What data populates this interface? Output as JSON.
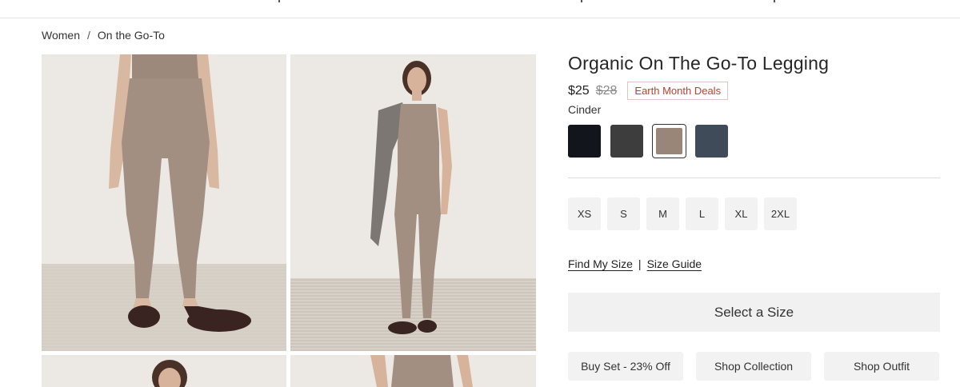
{
  "breadcrumb": {
    "items": [
      "Women",
      "On the Go-To"
    ],
    "separator": "/"
  },
  "product": {
    "title": "Organic On The Go-To Legging",
    "price": "$25",
    "original_price": "$28",
    "badge": "Earth Month Deals",
    "selected_color": "Cinder"
  },
  "swatches": [
    {
      "name": "black",
      "color": "#12151c",
      "selected": false
    },
    {
      "name": "charcoal",
      "color": "#3d3d3e",
      "selected": false
    },
    {
      "name": "cinder",
      "color": "#9a8678",
      "selected": true
    },
    {
      "name": "slate",
      "color": "#3f4b58",
      "selected": false
    }
  ],
  "sizes": [
    "XS",
    "S",
    "M",
    "L",
    "XL",
    "2XL"
  ],
  "links": {
    "find_size": "Find My Size",
    "separator": "|",
    "size_guide": "Size Guide"
  },
  "cta": {
    "select_size": "Select a Size"
  },
  "actions": [
    "Buy Set - 23% Off",
    "Shop Collection",
    "Shop Outfit"
  ],
  "colors": {
    "badge_text": "#b7412f",
    "button_bg": "#f2f2f2",
    "legging": "#a38f82"
  }
}
